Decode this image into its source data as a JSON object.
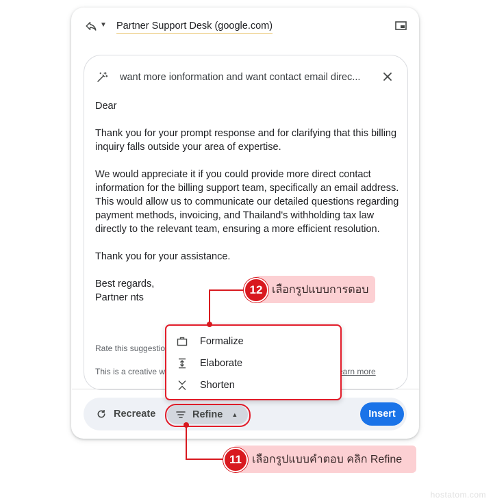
{
  "header": {
    "recipient": "Partner Support Desk (google.com)",
    "reply_icon": "reply-icon",
    "popout_icon": "popout-icon"
  },
  "prompt": {
    "text": "want more ionformation and want contact email direc...",
    "icon": "magic-wand-icon",
    "close_icon": "close-icon"
  },
  "draft": {
    "greeting": "Dear",
    "para1": "Thank you for your prompt response and for clarifying that this billing inquiry falls outside your area of expertise.",
    "para2": "We would appreciate it if you could provide more direct contact information for the billing support team, specifically an email address. This would allow us to communicate our detailed questions regarding payment methods, invoicing, and Thailand's withholding tax law directly to the relevant team, ensuring a more efficient resolution.",
    "para3": "Thank you for your assistance.",
    "closing": "Best regards,",
    "signature": "Partner nts"
  },
  "footer_meta": {
    "rate": "Rate this suggestio",
    "disclaimer": "This is a creative w",
    "learn_more": "earn more"
  },
  "refine_menu": {
    "items": [
      {
        "label": "Formalize",
        "icon": "briefcase-icon"
      },
      {
        "label": "Elaborate",
        "icon": "expand-icon"
      },
      {
        "label": "Shorten",
        "icon": "shorten-icon"
      }
    ]
  },
  "actions": {
    "recreate": "Recreate",
    "refine": "Refine",
    "insert": "Insert"
  },
  "annotations": {
    "step12_number": "12",
    "step12_text": "เลือกรูปแบบการตอบ",
    "step11_number": "11",
    "step11_text": "เลือกรูปแบบคำตอบ คลิก Refine"
  },
  "watermark": "hostatom.com",
  "colors": {
    "accent": "#1a73e8",
    "annotation_red": "#d8191f",
    "callout_pink": "#fcd0d3"
  }
}
